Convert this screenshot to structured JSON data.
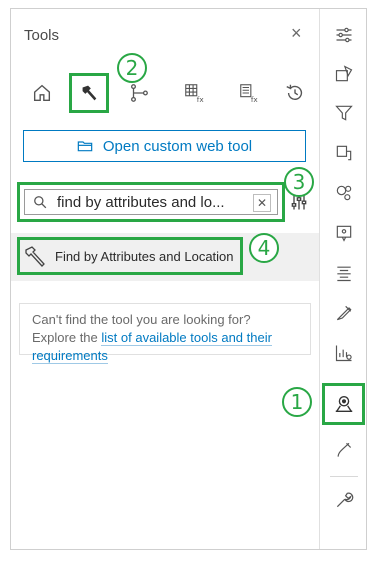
{
  "panel": {
    "title": "Tools",
    "close_glyph": "×",
    "tabs": [
      {
        "name": "home-icon"
      },
      {
        "name": "hammer-icon",
        "active": true
      },
      {
        "name": "network-icon"
      },
      {
        "name": "table-fx-icon"
      },
      {
        "name": "list-fx-icon"
      },
      {
        "name": "history-icon"
      }
    ]
  },
  "open_custom": {
    "label": "Open custom web tool",
    "icon": "folder-icon"
  },
  "search": {
    "query": "find by attributes and lo...",
    "clear_glyph": "✕"
  },
  "results": [
    {
      "label": "Find by Attributes and Location",
      "icon": "hammer-icon"
    }
  ],
  "help": {
    "text": "Can't find the tool you are looking for? Explore the",
    "link": "list of available tools and their requirements"
  },
  "markers": [
    "1",
    "2",
    "3",
    "4"
  ],
  "colors": {
    "accent": "#29a745",
    "link": "#007ac2"
  }
}
